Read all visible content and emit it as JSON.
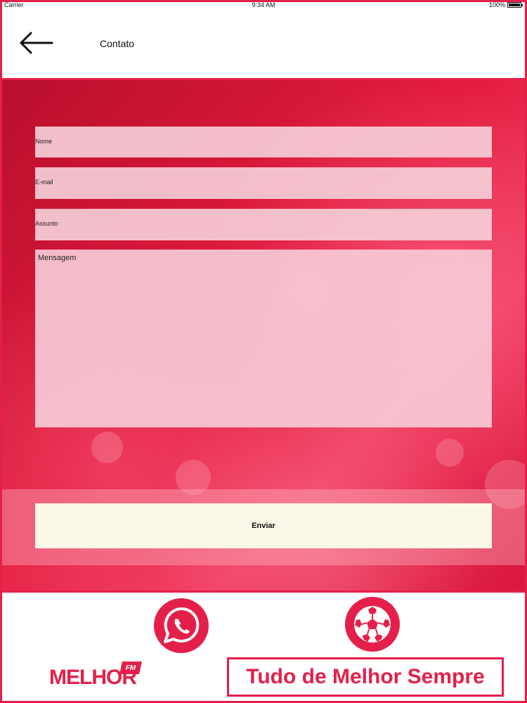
{
  "status_bar": {
    "carrier": "Carrier",
    "time": "9:34 AM",
    "battery": "100%"
  },
  "header": {
    "title": "Contato"
  },
  "form": {
    "name_placeholder": "Nome",
    "email_placeholder": "E-mail",
    "subject_placeholder": "Assunto",
    "message_placeholder": "Mensagem",
    "submit_label": "Enviar"
  },
  "footer": {
    "logo_text": "MELHOR",
    "logo_badge": "FM",
    "slogan": "Tudo de Melhor Sempre",
    "icons": [
      "whatsapp-icon",
      "soccer-ball-icon"
    ]
  },
  "colors": {
    "accent": "#e4204a",
    "button_bg": "#fbf8e9"
  }
}
